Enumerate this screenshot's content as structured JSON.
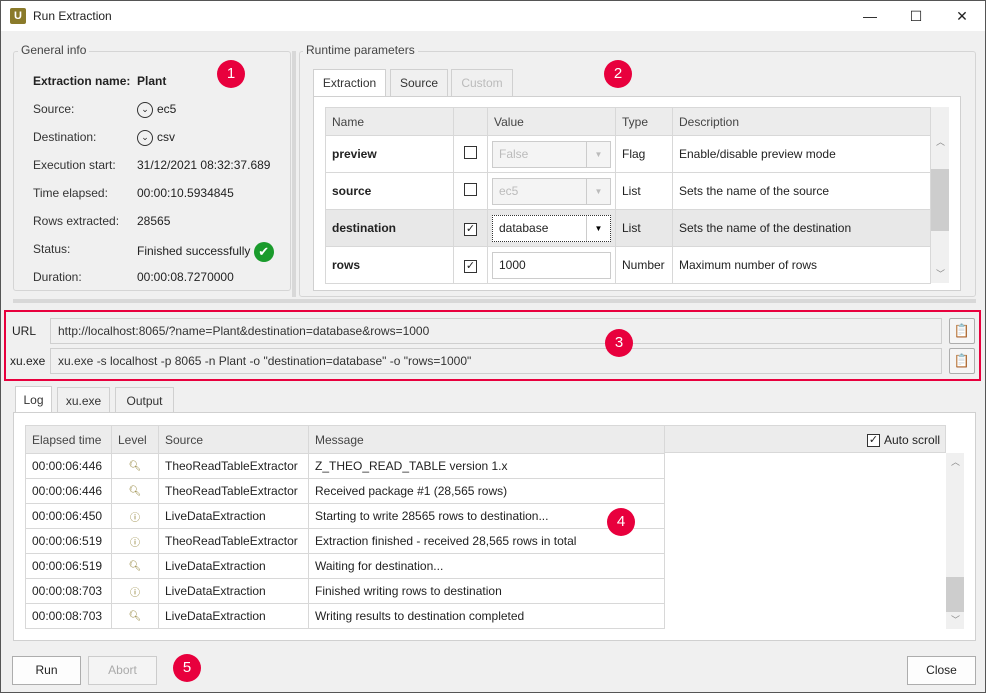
{
  "window": {
    "title": "Run Extraction",
    "logo": "U",
    "minimize": "—",
    "maximize": "☐",
    "close": "✕"
  },
  "general": {
    "title": "General info",
    "rows": [
      {
        "label": "Extraction name:",
        "value": "Plant"
      },
      {
        "label": "Source:",
        "value": "ec5"
      },
      {
        "label": "Destination:",
        "value": "csv"
      },
      {
        "label": "Execution start:",
        "value": "31/12/2021 08:32:37.689"
      },
      {
        "label": "Time elapsed:",
        "value": "00:00:10.5934845"
      },
      {
        "label": "Rows extracted:",
        "value": "28565"
      },
      {
        "label": "Status:",
        "value": "Finished successfully"
      },
      {
        "label": "Duration:",
        "value": "00:00:08.7270000"
      }
    ],
    "status_color": "#1a9b2c"
  },
  "runtime": {
    "title": "Runtime parameters",
    "tabs": [
      "Extraction",
      "Source",
      "Custom"
    ],
    "columns": [
      "Name",
      "",
      "Value",
      "Type",
      "Description"
    ],
    "rows": [
      {
        "name": "preview",
        "checked": false,
        "value": "False",
        "type": "Flag",
        "description": "Enable/disable preview mode"
      },
      {
        "name": "source",
        "checked": false,
        "value": "ec5",
        "type": "List",
        "description": "Sets the name of the source"
      },
      {
        "name": "destination",
        "checked": true,
        "value": "database",
        "type": "List",
        "description": "Sets the name of the destination"
      },
      {
        "name": "rows",
        "checked": true,
        "value": "1000",
        "type": "Number",
        "description": "Maximum number of rows"
      }
    ]
  },
  "commands": {
    "url_label": "URL",
    "url": "http://localhost:8065/?name=Plant&destination=database&rows=1000",
    "xu_label": "xu.exe",
    "xu": "xu.exe -s localhost -p 8065 -n Plant  -o \"destination=database\" -o \"rows=1000\""
  },
  "log": {
    "tabs": [
      "Log",
      "xu.exe",
      "Output"
    ],
    "columns": [
      "Elapsed time",
      "Level",
      "Source",
      "Message"
    ],
    "auto_scroll": "Auto scroll",
    "rows": [
      {
        "time": "00:00:06:446",
        "level": "debug",
        "source": "TheoReadTableExtractor",
        "message": "Z_THEO_READ_TABLE version 1.x"
      },
      {
        "time": "00:00:06:446",
        "level": "debug",
        "source": "TheoReadTableExtractor",
        "message": "Received package #1 (28,565 rows)"
      },
      {
        "time": "00:00:06:450",
        "level": "info",
        "source": "LiveDataExtraction",
        "message": "Starting to write 28565 rows to destination..."
      },
      {
        "time": "00:00:06:519",
        "level": "info",
        "source": "TheoReadTableExtractor",
        "message": "Extraction finished - received 28,565 rows in total"
      },
      {
        "time": "00:00:06:519",
        "level": "debug",
        "source": "LiveDataExtraction",
        "message": "Waiting for destination..."
      },
      {
        "time": "00:00:08:703",
        "level": "info",
        "source": "LiveDataExtraction",
        "message": "Finished writing rows to destination"
      },
      {
        "time": "00:00:08:703",
        "level": "debug",
        "source": "LiveDataExtraction",
        "message": "Writing results to destination completed"
      }
    ]
  },
  "buttons": {
    "run": "Run",
    "abort": "Abort",
    "close": "Close"
  },
  "badges": [
    "1",
    "2",
    "3",
    "4",
    "5"
  ],
  "accent": "#e8003d"
}
